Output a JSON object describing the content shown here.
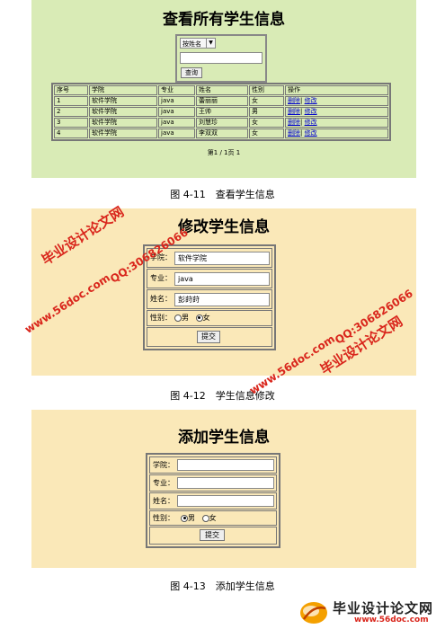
{
  "panel1": {
    "title": "查看所有学生信息",
    "search": {
      "select_value": "按姓名",
      "input_value": "",
      "button_label": "查询"
    },
    "table": {
      "headers": [
        "序号",
        "学院",
        "专业",
        "姓名",
        "性别",
        "操作"
      ],
      "rows": [
        [
          "1",
          "软件学院",
          "java",
          "蕾丽丽",
          "女"
        ],
        [
          "2",
          "软件学院",
          "java",
          "王帅",
          "男"
        ],
        [
          "3",
          "软件学院",
          "java",
          "刘慧珍",
          "女"
        ],
        [
          "4",
          "软件学院",
          "java",
          "李双双",
          "女"
        ]
      ],
      "action_delete": "删除",
      "action_separator": "|",
      "action_edit": "修改"
    },
    "pager": "第1 / 1页 1"
  },
  "caption1": "图 4-11　查看学生信息",
  "panel2": {
    "title": "修改学生信息",
    "college_label": "学院：",
    "college_value": "软件学院",
    "major_label": "专业：",
    "major_value": "java",
    "name_label": "姓名：",
    "name_value": "彭莳莳",
    "gender_label": "性别：",
    "gender_male": "男",
    "gender_female": "女",
    "gender_selected": "女",
    "submit_label": "提交"
  },
  "caption2": "图 4-12　学生信息修改",
  "panel3": {
    "title": "添加学生信息",
    "college_label": "学院：",
    "college_value": "",
    "major_label": "专业：",
    "major_value": "",
    "name_label": "姓名：",
    "name_value": "",
    "gender_label": "性别：",
    "gender_male": "男",
    "gender_female": "女",
    "gender_selected": "男",
    "submit_label": "提交"
  },
  "caption3": "图 4-13　添加学生信息",
  "watermarks": {
    "site_name": "毕业设计论文网",
    "url": "www.56doc.com",
    "qq": "QQ:306826066"
  },
  "footer_logo": {
    "name": "毕业设计论文网",
    "url": "www.56doc.com"
  },
  "colors": {
    "green_panel": "#d9ebb6",
    "yellow_panel": "#fae8b8",
    "watermark_red": "#d9261c",
    "link_blue": "#0000cc"
  }
}
